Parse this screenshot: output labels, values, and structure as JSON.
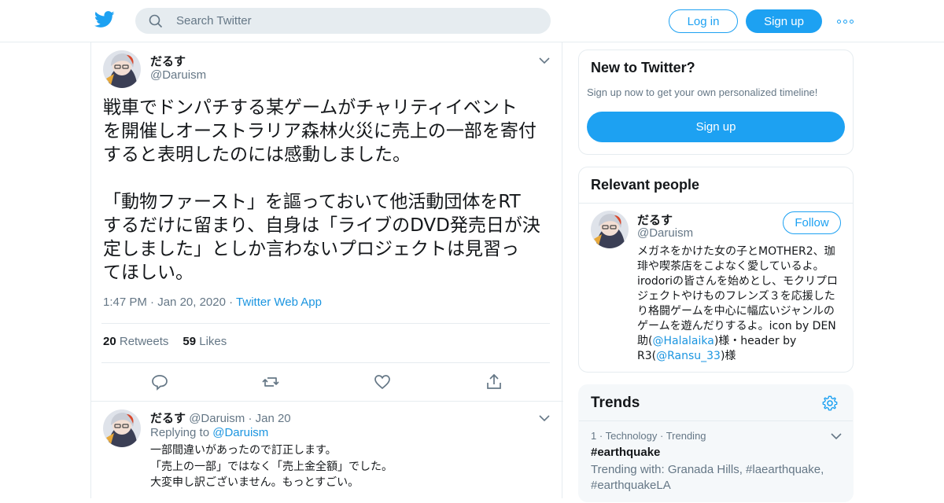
{
  "header": {
    "search_placeholder": "Search Twitter",
    "login_label": "Log in",
    "signup_label": "Sign up",
    "brand_color": "#1da1f2"
  },
  "tweet": {
    "name": "だるす",
    "handle": "@Daruism",
    "text": "戦車でドンパチする某ゲームがチャリティイベント\nを開催しオーストラリア森林火災に売上の一部を寄付\nすると表明したのには感動しました。\n\n「動物ファースト」を謳っておいて他活動団体をRT\nするだけに留まり、自身は「ライブのDVD発売日が決\n定しました」としか言わないプロジェクトは見習っ\nてほしい。",
    "time": "1:47 PM",
    "date": "Jan 20, 2020",
    "source": "Twitter Web App",
    "retweets_count": "20",
    "retweets_label": "Retweets",
    "likes_count": "59",
    "likes_label": "Likes"
  },
  "reply": {
    "name": "だるす",
    "handle": "@Daruism",
    "date": "Jan 20",
    "replying_label": "Replying to",
    "replying_to": "@Daruism",
    "text": "一部間違いがあったので訂正します。\n「売上の一部」ではなく「売上金全額」でした。\n大変申し訳ございません。もっとすごい。"
  },
  "sidebar": {
    "new": {
      "title": "New to Twitter?",
      "subtitle": "Sign up now to get your own personalized timeline!",
      "button": "Sign up"
    },
    "relevant": {
      "title": "Relevant people",
      "name": "だるす",
      "handle": "@Daruism",
      "follow": "Follow",
      "bio_text": "メガネをかけた女の子とMOTHER2、珈琲や喫茶店をこよなく愛しているよ。irodoriの皆さんを始めとし、モクリプロジェクトやけものフレンズ３を応援したり格闘ゲームを中心に幅広いジャンルのゲームを遊んだりするよ。icon by DEN助(",
      "bio_link1": "@Halalaika",
      "bio_mid": ")様・header by R3(",
      "bio_link2": "@Ransu_33",
      "bio_end": ")様"
    },
    "trends": {
      "title": "Trends",
      "item_rank": "1",
      "item_category": "Technology",
      "item_status": "Trending",
      "item_tag": "#earthquake",
      "item_with": "Trending with: Granada Hills, #laearthquake, #earthquakeLA"
    }
  }
}
